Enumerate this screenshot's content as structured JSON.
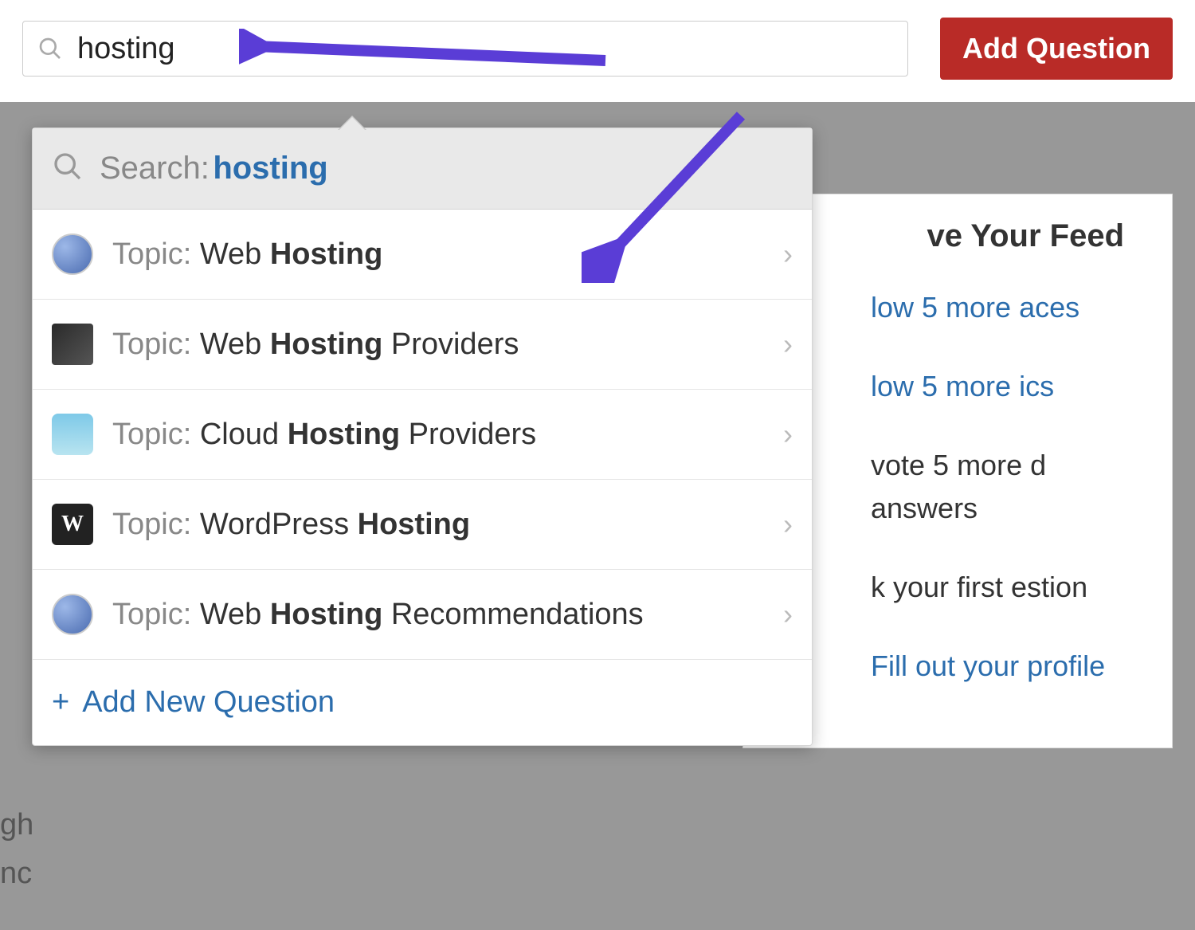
{
  "search": {
    "value": "hosting",
    "placeholder": ""
  },
  "top_button": {
    "label": "Add Question"
  },
  "dropdown": {
    "search_prefix": "Search:",
    "search_term": "hosting",
    "topic_prefix": "Topic:",
    "items": [
      {
        "icon": "globe",
        "name_pre": "Web ",
        "name_highlight": "Hosting",
        "name_post": ""
      },
      {
        "icon": "server",
        "name_pre": "Web ",
        "name_highlight": "Hosting",
        "name_post": " Providers"
      },
      {
        "icon": "cloud",
        "name_pre": "Cloud ",
        "name_highlight": "Hosting",
        "name_post": " Providers"
      },
      {
        "icon": "wp",
        "name_pre": "WordPress ",
        "name_highlight": "Hosting",
        "name_post": ""
      },
      {
        "icon": "globe",
        "name_pre": "Web ",
        "name_highlight": "Hosting",
        "name_post": " Recommendations"
      }
    ],
    "footer": {
      "label": "Add New Question"
    }
  },
  "sidebar": {
    "title_fragment": "ve Your Feed",
    "items": [
      "low 5 more aces",
      "low 5 more ics",
      "vote 5 more d answers",
      "k your first estion",
      "Fill out your profile"
    ]
  },
  "left_fragment_lines": [
    "gh",
    "nc"
  ],
  "colors": {
    "accent_red": "#b92b27",
    "link_blue": "#2b6dad",
    "arrow_purple": "#5a3dd6"
  }
}
